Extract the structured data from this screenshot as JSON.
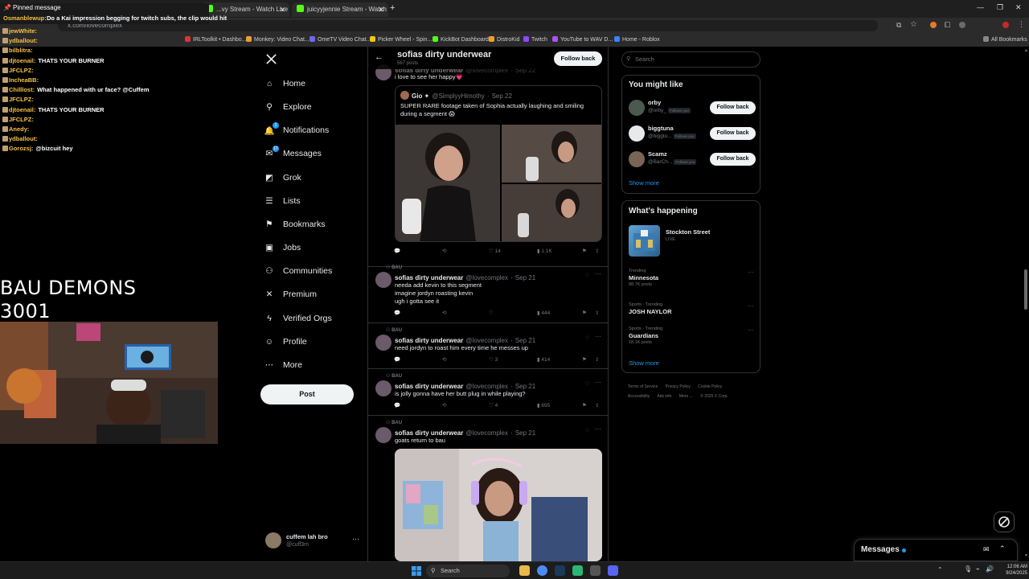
{
  "browser": {
    "tabs": [
      {
        "label": "...vy Stream - Watch Live on K"
      },
      {
        "label": "juicyyjennie Stream - Watch Li"
      }
    ],
    "url": "x.com/lovecomplex",
    "bookmarks": [
      "IRLToolkit • Dashbo...",
      "Monkey: Video Chat...",
      "OmeTV Video Chat...",
      "Picker Wheel - Spin...",
      "KickBot Dashboard",
      "DistroKid",
      "Twitch",
      "YouTube to WAV D...",
      "Home - Roblox"
    ],
    "all_bookmarks": "All Bookmarks"
  },
  "chat": {
    "pinned_label": "Pinned message",
    "pinned_user": "Osmanblewup:",
    "pinned_text": "Do a Kai impression begging for twitch subs, the clip would hit",
    "lines": [
      {
        "user": "jewWhite:",
        "text": ""
      },
      {
        "user": "ydballout:",
        "text": ""
      },
      {
        "user": "bilblitra:",
        "text": ""
      },
      {
        "user": "djtoenail:",
        "text": "THATS YOUR BURNER"
      },
      {
        "user": "JFCLPZ:",
        "text": ""
      },
      {
        "user": "IncheaBB:",
        "text": ""
      },
      {
        "user": "Chilllost:",
        "text": "What happened with ur face? @Cuffem"
      },
      {
        "user": "JFCLPZ:",
        "text": ""
      },
      {
        "user": "djtoenail:",
        "text": "THATS YOUR BURNER"
      },
      {
        "user": "JFCLPZ:",
        "text": ""
      },
      {
        "user": "Anedy:",
        "text": ""
      },
      {
        "user": "ydballout:",
        "text": ""
      },
      {
        "user": "Gorozsj:",
        "text": "@bizcuit hey"
      }
    ]
  },
  "overlay": {
    "title_line1": "BAU DEMONS",
    "title_line2": "3001"
  },
  "nav": {
    "items": [
      {
        "label": "Home",
        "icon": "home-icon"
      },
      {
        "label": "Explore",
        "icon": "search-icon"
      },
      {
        "label": "Notifications",
        "icon": "bell-icon",
        "badge": "1"
      },
      {
        "label": "Messages",
        "icon": "mail-icon",
        "badge": "17"
      },
      {
        "label": "Grok",
        "icon": "grok-icon"
      },
      {
        "label": "Lists",
        "icon": "list-icon"
      },
      {
        "label": "Bookmarks",
        "icon": "bookmark-icon"
      },
      {
        "label": "Jobs",
        "icon": "briefcase-icon"
      },
      {
        "label": "Communities",
        "icon": "people-icon"
      },
      {
        "label": "Premium",
        "icon": "x-logo-icon"
      },
      {
        "label": "Verified Orgs",
        "icon": "lightning-icon"
      },
      {
        "label": "Profile",
        "icon": "person-icon"
      },
      {
        "label": "More",
        "icon": "more-circle-icon"
      }
    ],
    "post_label": "Post",
    "account": {
      "name": "cuffem lah bro",
      "handle": "@cuff3m"
    }
  },
  "profile_header": {
    "name": "sofias dirty underwear",
    "posts": "567 posts",
    "follow_back": "Follow back"
  },
  "tweets": [
    {
      "name": "sofias dirty underwear",
      "handle": "@lovecomplex",
      "date": "Sep 22",
      "text": "i love to see her happy💗",
      "quote": {
        "name": "Gio ✦",
        "handle": "@SimplyyHimothy",
        "date": "Sep 22",
        "text": "SUPER RARE footage taken of Sophia actually laughing and smiling during a segment 😱"
      },
      "replies": "",
      "reposts": "",
      "likes": "14",
      "views": "1.1K"
    },
    {
      "community": "BAU",
      "name": "sofias dirty underwear",
      "handle": "@lovecomplex",
      "date": "Sep 21",
      "text_lines": [
        "needa add kevin to this segment",
        "imagine jordyn roasting kevin",
        "ugh i gotta see it"
      ],
      "replies": "",
      "reposts": "",
      "likes": "",
      "views": "444"
    },
    {
      "community": "BAU",
      "name": "sofias dirty underwear",
      "handle": "@lovecomplex",
      "date": "Sep 21",
      "text": "need jordyn to roast him every time he messes up",
      "replies": "",
      "reposts": "",
      "likes": "3",
      "views": "414"
    },
    {
      "community": "BAU",
      "name": "sofias dirty underwear",
      "handle": "@lovecomplex",
      "date": "Sep 21",
      "text": "is jolly gonna have her butt plug in while playing?",
      "replies": "",
      "reposts": "",
      "likes": "4",
      "views": "695"
    },
    {
      "community": "BAU",
      "name": "sofias dirty underwear",
      "handle": "@lovecomplex",
      "date": "Sep 21",
      "text": "goats return to bau"
    }
  ],
  "sidebar": {
    "search_placeholder": "Search",
    "wtf_title": "You might like",
    "wtf": [
      {
        "name": "orby",
        "handle": "@orby_",
        "follows_you": "Follows you",
        "button": "Follow back"
      },
      {
        "name": "biggtuna",
        "handle": "@biggtu...",
        "follows_you": "Follows you",
        "button": "Follow back"
      },
      {
        "name": "Scamz",
        "handle": "@BarCh...",
        "follows_you": "Follows you",
        "button": "Follow back"
      }
    ],
    "show_more": "Show more",
    "happening_title": "What's happening",
    "live_event": {
      "title": "Stockton Street",
      "status": "LIVE"
    },
    "trends": [
      {
        "context": "Trending",
        "title": "Minnesota",
        "count": "88.7K posts"
      },
      {
        "context": "Sports · Trending",
        "title": "JOSH NAYLOR",
        "count": ""
      },
      {
        "context": "Sports · Trending",
        "title": "Guardians",
        "count": "18.1K posts"
      }
    ],
    "footer": [
      "Terms of Service",
      "Privacy Policy",
      "Cookie Policy",
      "Accessibility",
      "Ads info",
      "More ...",
      "© 2025 X Corp."
    ]
  },
  "messages_drawer": {
    "label": "Messages"
  },
  "taskbar": {
    "search": "Search",
    "time": "12:06 AM",
    "date": "9/24/2025"
  },
  "colors": {
    "accent": "#1d9bf0",
    "bg": "#000000",
    "border": "#2f3336"
  }
}
